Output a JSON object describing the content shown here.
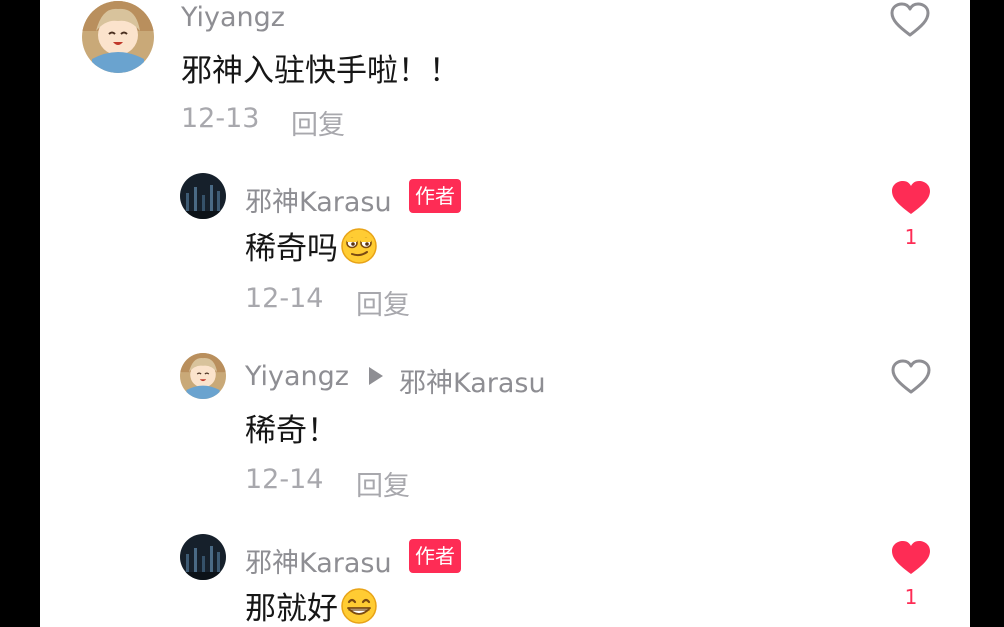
{
  "comments": [
    {
      "username": "Yiyangz",
      "text": "邪神入驻快手啦！！",
      "date": "12-13",
      "reply_label": "回复",
      "liked": false,
      "avatar_icon": "anime-girl-avatar",
      "like_icon": "heart-outline-icon"
    },
    {
      "username": "邪神Karasu",
      "author_badge": "作者",
      "text": "稀奇吗",
      "emoji_icon": "smirk-emoji-icon",
      "date": "12-14",
      "reply_label": "回复",
      "liked": true,
      "like_count": "1",
      "avatar_icon": "dark-night-avatar",
      "like_icon": "heart-filled-icon"
    },
    {
      "username": "Yiyangz",
      "reply_to": "邪神Karasu",
      "text": "稀奇！",
      "date": "12-14",
      "reply_label": "回复",
      "liked": false,
      "avatar_icon": "anime-girl-avatar",
      "like_icon": "heart-outline-icon"
    },
    {
      "username": "邪神Karasu",
      "author_badge": "作者",
      "text": "那就好",
      "emoji_icon": "grin-emoji-icon",
      "liked": true,
      "like_count": "1",
      "avatar_icon": "dark-night-avatar",
      "like_icon": "heart-filled-icon"
    }
  ],
  "colors": {
    "accent": "#fe2c55",
    "name_gray": "#8e8e93",
    "meta_gray": "#a8a8ad",
    "text": "#161616",
    "frame": "#000000",
    "panel": "#ffffff"
  }
}
